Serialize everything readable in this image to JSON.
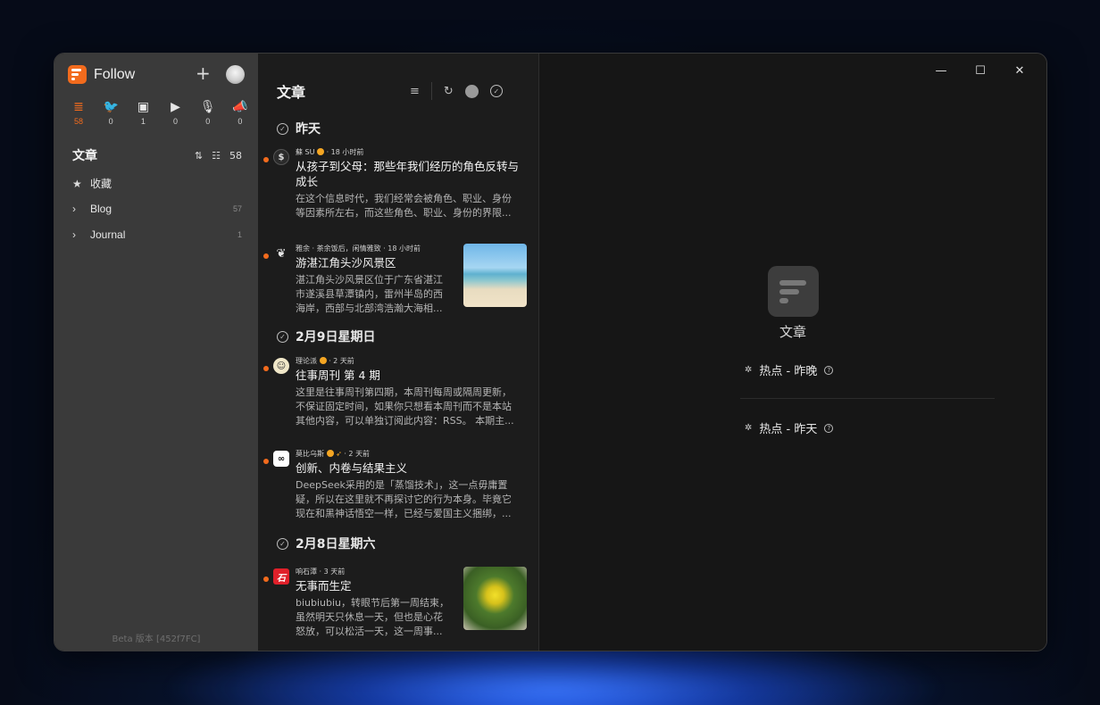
{
  "sidebar": {
    "app_name": "Follow",
    "feed_types": [
      {
        "icon": "article-icon",
        "glyph": "≣",
        "count": "58",
        "active": true
      },
      {
        "icon": "twitter-icon",
        "glyph": "🐦",
        "count": "0"
      },
      {
        "icon": "picture-icon",
        "glyph": "▣",
        "count": "1"
      },
      {
        "icon": "video-icon",
        "glyph": "▶",
        "count": "0"
      },
      {
        "icon": "microphone-icon",
        "glyph": "🎙",
        "count": "0"
      },
      {
        "icon": "megaphone-icon",
        "glyph": "📣",
        "count": "0"
      }
    ],
    "section_title": "文章",
    "section_count": "58",
    "favorites_label": "收藏",
    "items": [
      {
        "label": "Blog",
        "count": "57"
      },
      {
        "label": "Journal",
        "count": "1"
      }
    ],
    "version": "Beta 版本 [452f7FC]"
  },
  "list": {
    "title": "文章",
    "days": [
      "昨天",
      "2月9日星期日",
      "2月8日星期六"
    ],
    "entries": [
      {
        "source": "蘇 SU",
        "time": "· 18 小时前",
        "title_line1": "从孩子到父母：那些年我们经历的角色反转与",
        "title_line2": "成长",
        "desc_line1": "在这个信息时代，我们经常会被角色、职业、身份",
        "desc_line2": "等因素所左右，而这些角色、职业、身份的界限..."
      },
      {
        "source": "雅余 · 茶余饭后，闲情雅致",
        "time": "· 18 小时前",
        "title_line1": "游湛江角头沙风景区",
        "desc_line1": "湛江角头沙风景区位于广东省湛江",
        "desc_line2": "市遂溪县草潭镇内，雷州半岛的西",
        "desc_line3": "海岸，西部与北部湾浩瀚大海相..."
      },
      {
        "source": "理论派",
        "time": "· 2 天前",
        "title_line1": "往事周刊 第 4 期",
        "desc_line1": "这里是往事周刊第四期，本周刊每周或隔周更新，",
        "desc_line2": "不保证固定时间，如果你只想看本周刊而不是本站",
        "desc_line3": "其他内容，可以单独订阅此内容：RSS。 本期主..."
      },
      {
        "source": "莫比乌斯",
        "time": "· 2 天前",
        "title_line1": "创新、内卷与结果主义",
        "desc_line1": "DeepSeek采用的是「蒸馏技术」，这一点毋庸置",
        "desc_line2": "疑，所以在这里就不再探讨它的行为本身。毕竟它",
        "desc_line3": "现在和黑神话悟空一样，已经与爱国主义捆绑，..."
      },
      {
        "source": "响石潭",
        "time": "· 3 天前",
        "title_line1": "无事而生定",
        "desc_line1": "biubiubiu，转眼节后第一周结束，",
        "desc_line2": "虽然明天只休息一天，但也是心花",
        "desc_line3": "怒放，可以松活一天，这一周事..."
      }
    ]
  },
  "content": {
    "empty_title": "文章",
    "hot_items": [
      "热点 - 昨晚",
      "热点 - 昨天"
    ]
  },
  "colors": {
    "accent": "#f26b1d",
    "verified": "#f5a623"
  }
}
